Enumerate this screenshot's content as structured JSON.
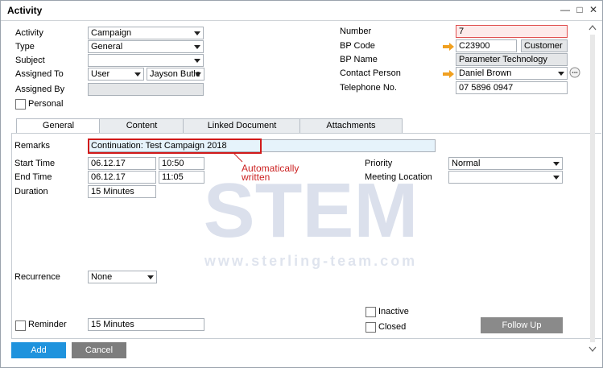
{
  "window": {
    "title": "Activity"
  },
  "left": {
    "activity": {
      "label": "Activity",
      "value": "Campaign"
    },
    "type": {
      "label": "Type",
      "value": "General"
    },
    "subject": {
      "label": "Subject",
      "value": ""
    },
    "assigned_to": {
      "label": "Assigned To",
      "value": "User",
      "user": "Jayson Butle"
    },
    "assigned_by": {
      "label": "Assigned By",
      "value": ""
    },
    "personal": {
      "label": "Personal"
    }
  },
  "right": {
    "number": {
      "label": "Number",
      "value": "7"
    },
    "bp_code": {
      "label": "BP Code",
      "value": "C23900",
      "type": "Customer"
    },
    "bp_name": {
      "label": "BP Name",
      "value": "Parameter Technology"
    },
    "contact_person": {
      "label": "Contact Person",
      "value": "Daniel Brown"
    },
    "telephone": {
      "label": "Telephone No.",
      "value": "07 5896 0947"
    }
  },
  "tabs": [
    "General",
    "Content",
    "Linked Document",
    "Attachments"
  ],
  "general": {
    "remarks": {
      "label": "Remarks",
      "value": "Continuation: Test Campaign 2018"
    },
    "start_time": {
      "label": "Start Time",
      "date": "06.12.17",
      "time": "10:50"
    },
    "end_time": {
      "label": "End Time",
      "date": "06.12.17",
      "time": "11:05"
    },
    "duration": {
      "label": "Duration",
      "value": "15 Minutes"
    },
    "priority": {
      "label": "Priority",
      "value": "Normal"
    },
    "meeting_location": {
      "label": "Meeting Location",
      "value": ""
    },
    "recurrence": {
      "label": "Recurrence",
      "value": "None"
    },
    "reminder": {
      "label": "Reminder",
      "value": "15 Minutes"
    },
    "inactive": {
      "label": "Inactive"
    },
    "closed": {
      "label": "Closed"
    },
    "follow_up": "Follow Up"
  },
  "annotation": {
    "line1": "Automatically",
    "line2": "written"
  },
  "watermark": {
    "brand": "STEM",
    "url": "www.sterling-team.com"
  },
  "buttons": {
    "add": "Add",
    "cancel": "Cancel"
  },
  "colors": {
    "add_button": "#1f93dd",
    "cancel_button": "#7d7d7d",
    "follow_up_button": "#8a8a8a",
    "annotation": "#cc2222",
    "link_arrow": "#f0a020"
  }
}
